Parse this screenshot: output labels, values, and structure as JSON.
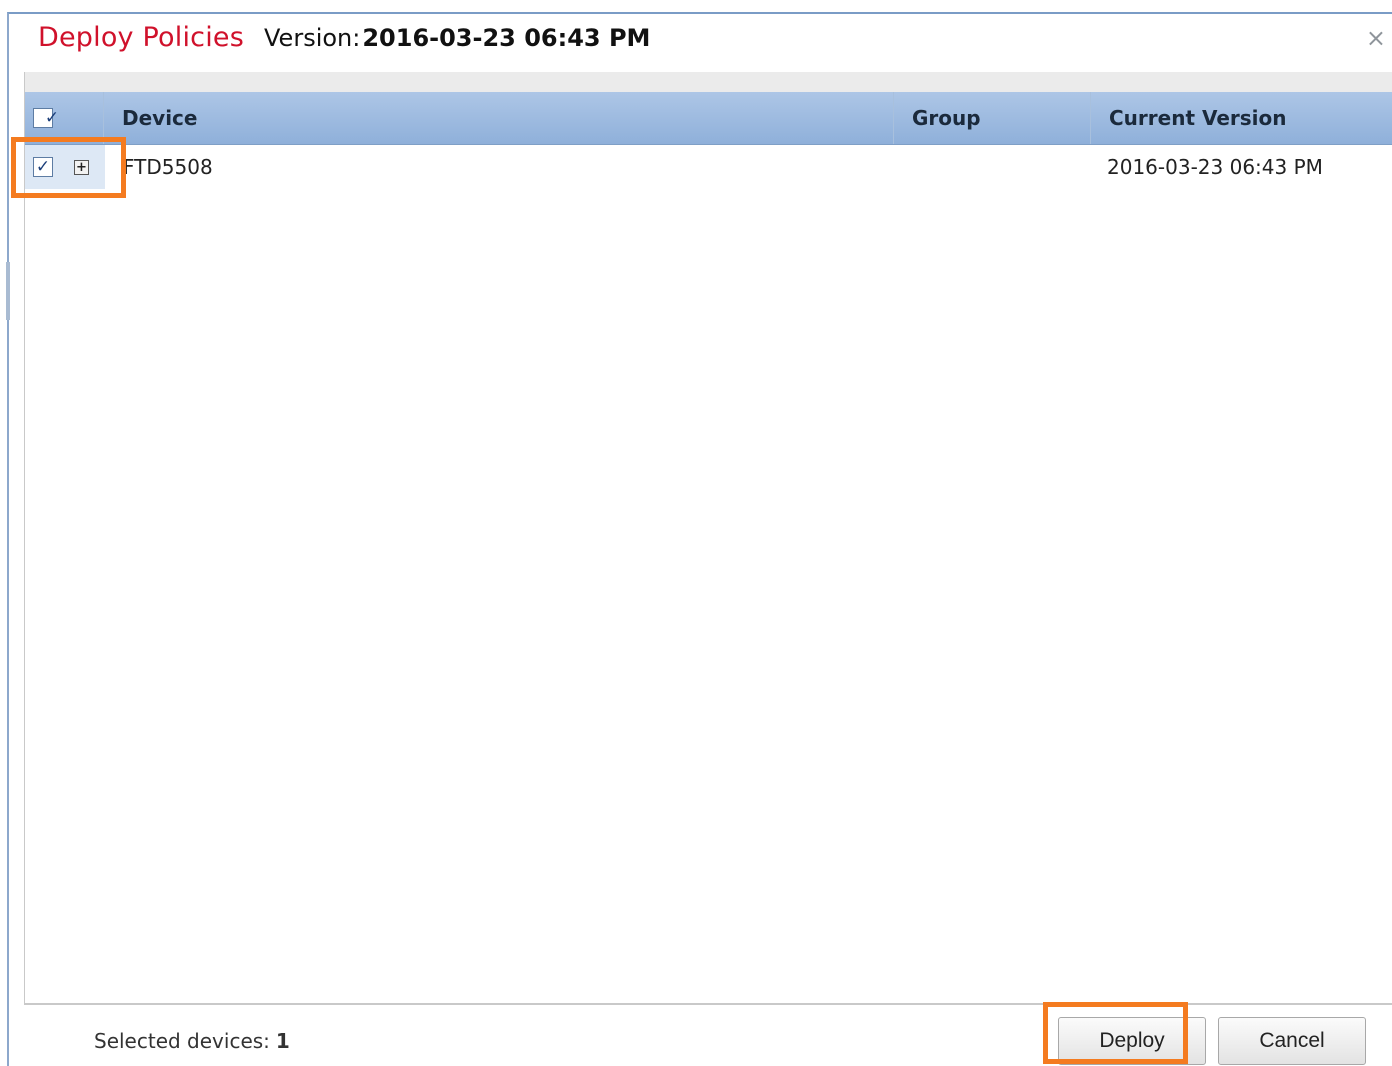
{
  "dialog": {
    "title": "Deploy Policies",
    "version_label": "Version:",
    "version_value": "2016-03-23 06:43 PM",
    "close_glyph": "×"
  },
  "table": {
    "header_select_all_checked": true,
    "columns": [
      "Device",
      "Group",
      "Current Version"
    ],
    "rows": [
      {
        "checked": true,
        "expand_glyph": "+",
        "device": "FTD5508",
        "group": "",
        "current_version": "2016-03-23 06:43 PM"
      }
    ]
  },
  "footer": {
    "selected_label": "Selected devices:",
    "selected_count": "1",
    "deploy_label": "Deploy",
    "cancel_label": "Cancel"
  },
  "colors": {
    "title": "#d0112b",
    "header_bg": "#9dbbe0",
    "highlight": "#f47b20"
  },
  "icons": {
    "checkbox": "checkbox-checked-icon",
    "expand": "expand-plus-icon",
    "close": "close-icon"
  }
}
